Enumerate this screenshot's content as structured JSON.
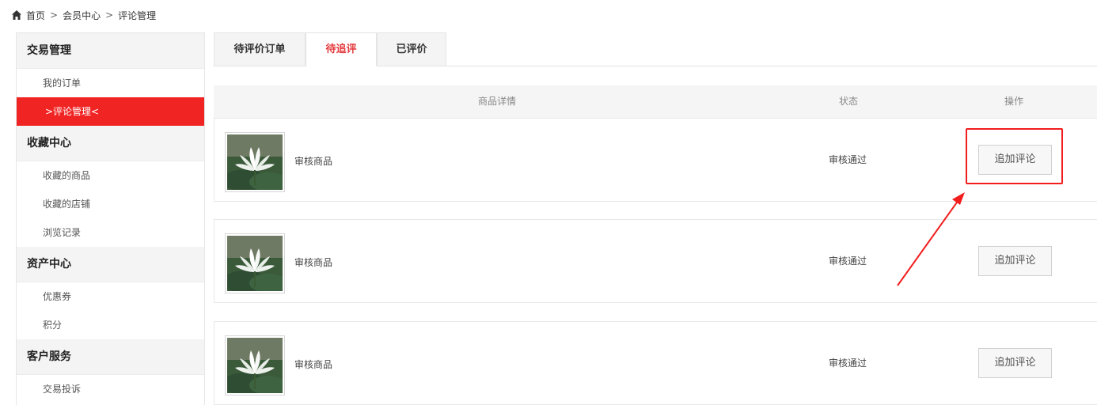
{
  "breadcrumb": {
    "items": [
      "首页",
      "会员中心",
      "评论管理"
    ],
    "separator": ">"
  },
  "sidebar": {
    "groups": [
      {
        "title": "交易管理",
        "items": [
          "我的订单",
          ">评论管理<"
        ]
      },
      {
        "title": "收藏中心",
        "items": [
          "收藏的商品",
          "收藏的店铺",
          "浏览记录"
        ]
      },
      {
        "title": "资产中心",
        "items": [
          "优惠券",
          "积分"
        ]
      },
      {
        "title": "客户服务",
        "items": [
          "交易投诉"
        ]
      }
    ]
  },
  "tabs": [
    "待评价订单",
    "待追评",
    "已评价"
  ],
  "active_tab": 1,
  "table": {
    "headers": [
      "商品详情",
      "状态",
      "操作"
    ],
    "rows": [
      {
        "product": "审核商品",
        "status": "审核通过",
        "action": "追加评论"
      },
      {
        "product": "审核商品",
        "status": "审核通过",
        "action": "追加评论"
      },
      {
        "product": "审核商品",
        "status": "审核通过",
        "action": "追加评论"
      }
    ]
  },
  "icons": {
    "home": "home-icon",
    "thumbnail": "lotus-flower-image"
  },
  "colors": {
    "accent": "#f12424",
    "active_tab_text": "#e4393c",
    "annotation": "#f21d1d"
  }
}
